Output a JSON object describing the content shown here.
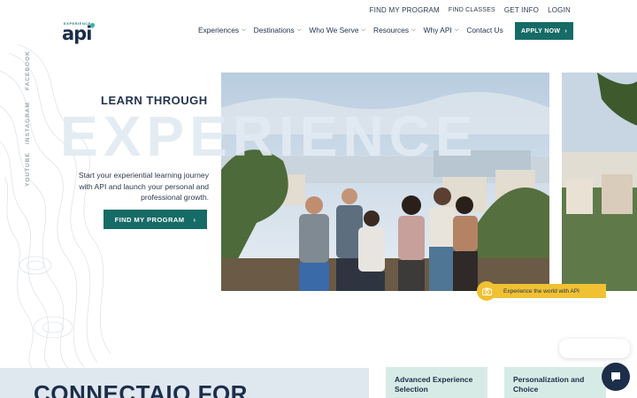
{
  "top_links": [
    "FIND MY PROGRAM",
    "FIND CLASSES",
    "GET INFO",
    "LOGIN"
  ],
  "logo": {
    "small": "EXPERIENCE",
    "big": "api"
  },
  "nav": {
    "items": [
      {
        "label": "Experiences",
        "dropdown": true
      },
      {
        "label": "Destinations",
        "dropdown": true
      },
      {
        "label": "Who We Serve",
        "dropdown": true
      },
      {
        "label": "Resources",
        "dropdown": true
      },
      {
        "label": "Why API",
        "dropdown": true
      },
      {
        "label": "Contact Us",
        "dropdown": false
      }
    ],
    "apply_label": "APPLY NOW"
  },
  "social": [
    "FACEBOOK",
    "INSTAGRAM",
    "YOUTUBE"
  ],
  "hero": {
    "kicker": "LEARN THROUGH",
    "headline": "EXPERIENCE",
    "intro": "Start your experiential learning journey with API and launch your personal and professional growth.",
    "cta": "FIND MY PROGRAM",
    "caption": "Experience the world with API"
  },
  "bottom": {
    "heading": "CONNECTAIO FOR",
    "cards": [
      "Advanced Experience Selection",
      "Personalization and Choice"
    ]
  },
  "colors": {
    "brand": "#176b66",
    "navy": "#1c2e4a",
    "accent": "#f0c132"
  }
}
